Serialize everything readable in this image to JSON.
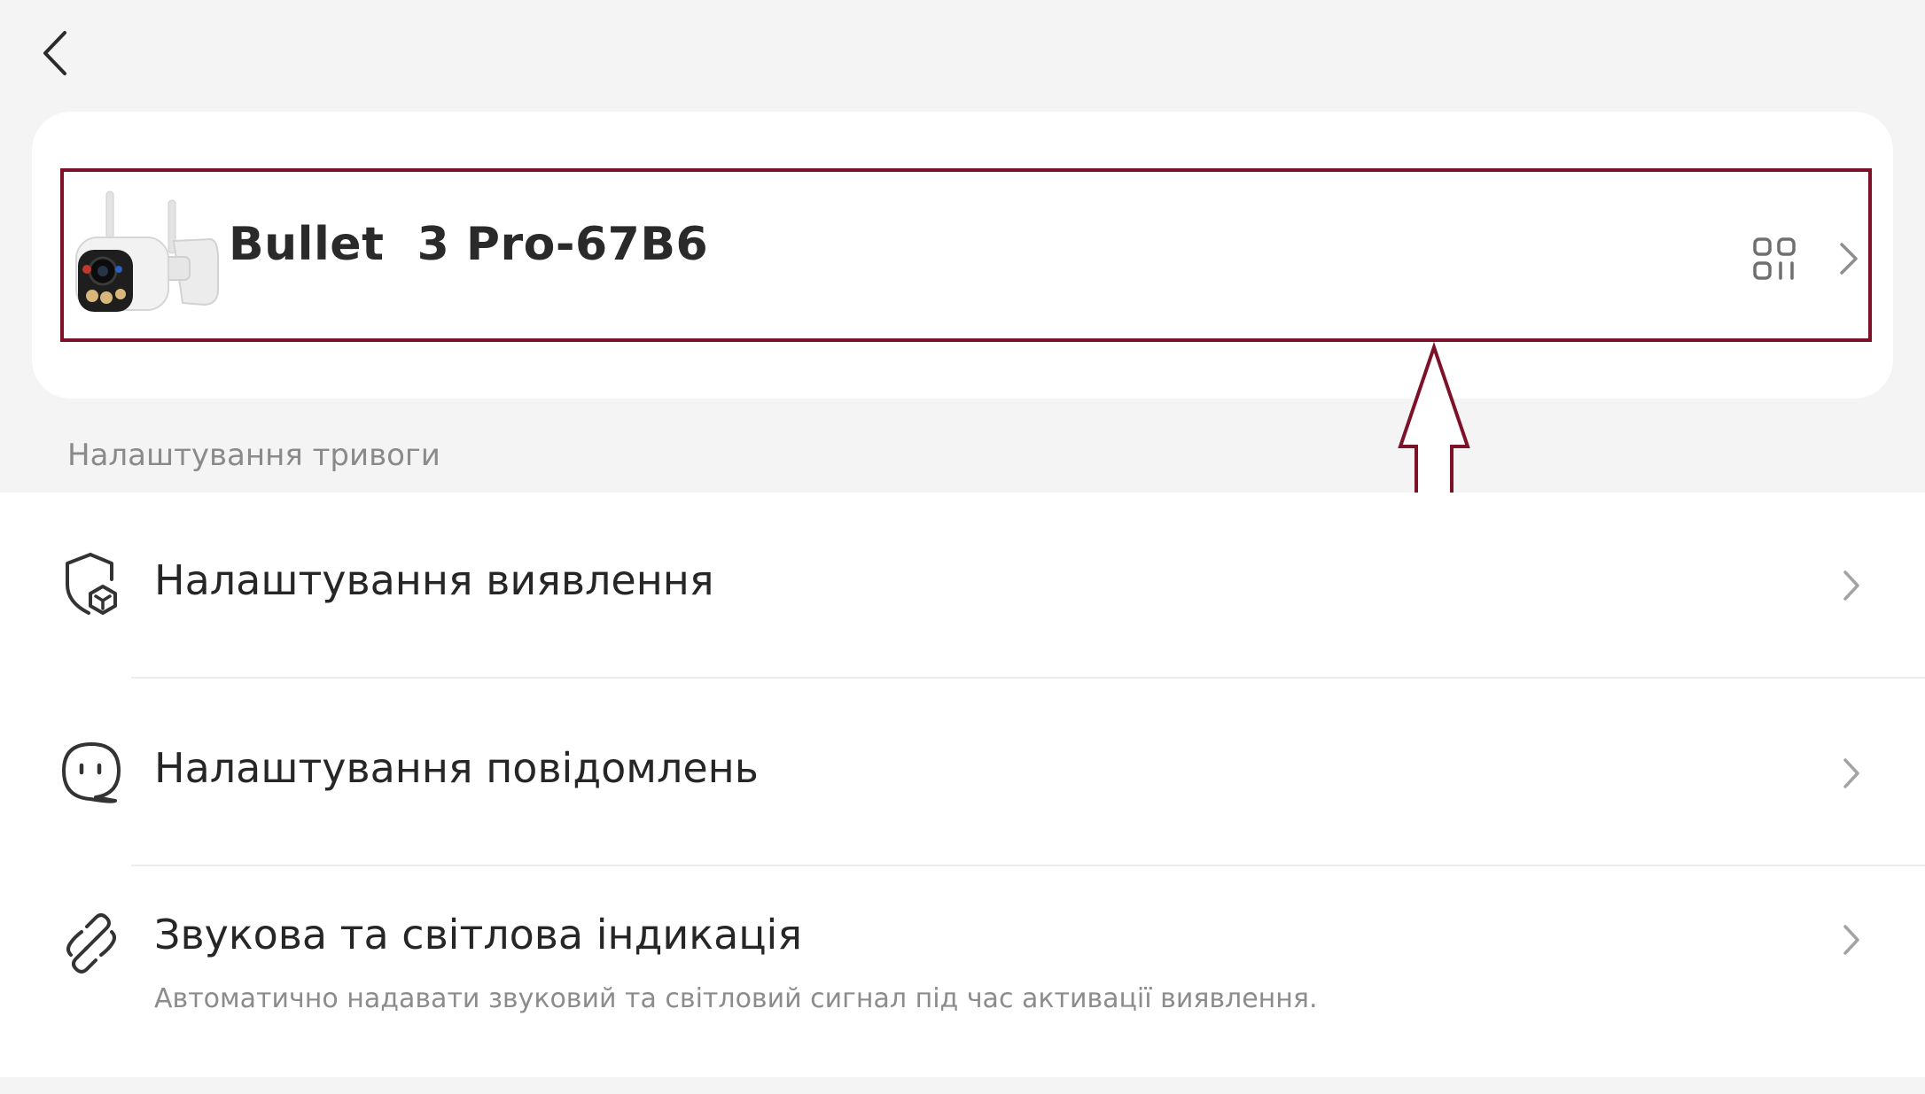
{
  "colors": {
    "background": "#f4f4f4",
    "card": "#ffffff",
    "highlight_border": "#7d1128",
    "section_text": "#8a8a8a"
  },
  "header": {
    "back_icon": "chevron-left-icon"
  },
  "device": {
    "name": "Bullet  3 Pro-67B6",
    "thumbnail": "bullet-camera-image",
    "qr_icon": "qr-code-icon",
    "chevron_icon": "chevron-right-icon"
  },
  "alarm_section": {
    "title": "Налаштування тривоги",
    "items": [
      {
        "label": "Налаштування виявлення",
        "icon": "shield-detection-icon"
      },
      {
        "label": "Налаштування повідомлень",
        "icon": "message-bubble-icon"
      },
      {
        "label": "Звукова та світлова індикація",
        "description": "Автоматично надавати звуковий та світловий сигнал під час активації виявлення.",
        "icon": "link-icon"
      }
    ]
  }
}
